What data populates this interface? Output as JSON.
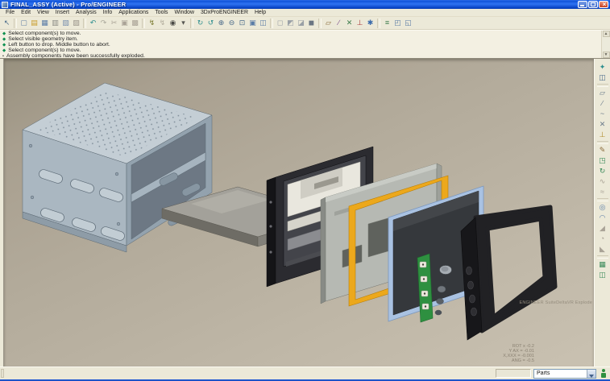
{
  "window": {
    "title": "FINAL_ASSY (Active) - Pro/ENGINEER",
    "controls": [
      "minimize",
      "restore",
      "close"
    ]
  },
  "menu": {
    "items": [
      {
        "label": "File",
        "name": "file"
      },
      {
        "label": "Edit",
        "name": "edit"
      },
      {
        "label": "View",
        "name": "view"
      },
      {
        "label": "Insert",
        "name": "insert"
      },
      {
        "label": "Analysis",
        "name": "analysis"
      },
      {
        "label": "Info",
        "name": "info"
      },
      {
        "label": "Applications",
        "name": "applications"
      },
      {
        "label": "Tools",
        "name": "tools"
      },
      {
        "label": "Window",
        "name": "window"
      },
      {
        "label": "3DxProENGINEER",
        "name": "3dxproengineer"
      },
      {
        "label": "Help",
        "name": "help"
      }
    ]
  },
  "toolbar": {
    "icons": [
      {
        "name": "select",
        "glyph": "↖",
        "color": "#4a6a8a"
      },
      {
        "cls": "sep"
      },
      {
        "name": "new",
        "glyph": "▢",
        "color": "#6a86a8"
      },
      {
        "name": "open",
        "glyph": "▤",
        "color": "#c99b28"
      },
      {
        "name": "save",
        "glyph": "▦",
        "color": "#5a7ca6"
      },
      {
        "name": "print",
        "glyph": "▥",
        "color": "#8a8a84"
      },
      {
        "name": "save-copy",
        "glyph": "▧",
        "color": "#7a90ae"
      },
      {
        "name": "erase",
        "glyph": "▨",
        "color": "#9a948a"
      },
      {
        "cls": "sep"
      },
      {
        "name": "undo",
        "glyph": "↶",
        "color": "#2f8f8f"
      },
      {
        "name": "redo",
        "glyph": "↷",
        "color": "#a9a79a"
      },
      {
        "name": "cut",
        "glyph": "✂",
        "color": "#a9a296"
      },
      {
        "name": "copy",
        "glyph": "▣",
        "color": "#a9a296"
      },
      {
        "name": "paste",
        "glyph": "▩",
        "color": "#a9a296"
      },
      {
        "cls": "sep"
      },
      {
        "name": "regenerate",
        "glyph": "↯",
        "color": "#7a7a30"
      },
      {
        "name": "regen-manager",
        "glyph": "↯",
        "color": "#b3ad9e"
      },
      {
        "name": "search",
        "glyph": "◉",
        "color": "#4a4a46"
      },
      {
        "name": "search-menu",
        "glyph": "▾",
        "color": "#555550"
      },
      {
        "cls": "sep"
      },
      {
        "name": "spin",
        "glyph": "↻",
        "color": "#2f8f8f"
      },
      {
        "name": "pan-zoom",
        "glyph": "↺",
        "color": "#2f8f8f"
      },
      {
        "name": "zoom-in",
        "glyph": "⊕",
        "color": "#4a6a8a"
      },
      {
        "name": "zoom-out",
        "glyph": "⊖",
        "color": "#4a6a8a"
      },
      {
        "name": "refit",
        "glyph": "⊡",
        "color": "#4a6a8a"
      },
      {
        "name": "repaint",
        "glyph": "▣",
        "color": "#5a7ca6"
      },
      {
        "name": "saved-views",
        "glyph": "◫",
        "color": "#5a7ca6"
      },
      {
        "cls": "sep"
      },
      {
        "name": "wireframe",
        "glyph": "◻",
        "color": "#9aa0a6"
      },
      {
        "name": "hidden-line",
        "glyph": "◩",
        "color": "#9aa0a6"
      },
      {
        "name": "no-hidden",
        "glyph": "◪",
        "color": "#9aa0a6"
      },
      {
        "name": "shaded",
        "glyph": "◼",
        "color": "#6a7582"
      },
      {
        "cls": "sep"
      },
      {
        "name": "datum-planes",
        "glyph": "▱",
        "color": "#8a6a3a"
      },
      {
        "name": "datum-axes",
        "glyph": "∕",
        "color": "#7a4a8a"
      },
      {
        "name": "datum-points",
        "glyph": "✕",
        "color": "#3a7a4a"
      },
      {
        "name": "datum-csys",
        "glyph": "⊥",
        "color": "#aa3a3a"
      },
      {
        "name": "spin-center",
        "glyph": "✱",
        "color": "#3a6aaa"
      },
      {
        "cls": "sep"
      },
      {
        "name": "model-tree",
        "glyph": "≡",
        "color": "#3a7a4a"
      },
      {
        "name": "info-window",
        "glyph": "◰",
        "color": "#5a7ca6"
      },
      {
        "name": "close-window",
        "glyph": "◱",
        "color": "#5a7ca6"
      }
    ]
  },
  "messages": {
    "lines": [
      {
        "glyph": "◆",
        "color": "#0c8f4e",
        "text": "Select component(s) to move."
      },
      {
        "glyph": "◆",
        "color": "#0c8f4e",
        "text": "Select visible geometry item."
      },
      {
        "glyph": "◆",
        "color": "#0c8f4e",
        "text": "Left button to drop.  Middle button to abort."
      },
      {
        "glyph": "◆",
        "color": "#0c8f4e",
        "text": "Select component(s) to move."
      },
      {
        "glyph": "•",
        "color": "#2a2a2a",
        "text": "Assembly components have been successfully exploded."
      }
    ]
  },
  "viewport": {
    "watermark": "ENGINEER SuiteDeltaVR Explode",
    "readout": [
      "ROT x  -0.2",
      "Y AX = -0.01",
      "X,XXX = -0.001",
      "ANG = -0.5"
    ]
  },
  "feature_toolbar": {
    "icons": [
      {
        "name": "named-views",
        "glyph": "✦",
        "color": "#2f8f8f"
      },
      {
        "name": "view-manager",
        "glyph": "◫",
        "color": "#4a6a8a"
      },
      {
        "cls": "vsep"
      },
      {
        "name": "datum-plane-tool",
        "glyph": "▱",
        "color": "#6a7a8a"
      },
      {
        "name": "datum-axis-tool",
        "glyph": "∕",
        "color": "#6a7a8a"
      },
      {
        "name": "datum-curve-tool",
        "glyph": "~",
        "color": "#6a7a8a"
      },
      {
        "name": "datum-point-tool",
        "glyph": "✕",
        "color": "#6a7a8a"
      },
      {
        "name": "coord-system-tool",
        "glyph": "⊥",
        "color": "#b08a2a"
      },
      {
        "cls": "vsep"
      },
      {
        "name": "sketch-tool",
        "glyph": "✎",
        "color": "#8a6a3a"
      },
      {
        "name": "extrude-tool",
        "glyph": "◳",
        "color": "#3a8a5a"
      },
      {
        "name": "revolve-tool",
        "glyph": "↻",
        "color": "#3a8a5a"
      },
      {
        "name": "sweep-tool",
        "glyph": "∿",
        "color": "#a9a296"
      },
      {
        "name": "blend-tool",
        "glyph": "≈",
        "color": "#a9a296"
      },
      {
        "cls": "vsep"
      },
      {
        "name": "hole-tool",
        "glyph": "◎",
        "color": "#5a7ca6"
      },
      {
        "name": "round-tool",
        "glyph": "◠",
        "color": "#5a7ca6"
      },
      {
        "name": "chamfer-tool",
        "glyph": "◢",
        "color": "#a9a296"
      },
      {
        "name": "shell-tool",
        "glyph": "◔",
        "color": "#a9a296"
      },
      {
        "name": "draft-tool",
        "glyph": "◣",
        "color": "#a9a296"
      },
      {
        "cls": "vsep"
      },
      {
        "name": "pattern-tool",
        "glyph": "▦",
        "color": "#3a8a5a"
      },
      {
        "name": "mirror-tool",
        "glyph": "◫",
        "color": "#3a8a5a"
      }
    ]
  },
  "statusbar": {
    "filter_label": "Parts"
  }
}
